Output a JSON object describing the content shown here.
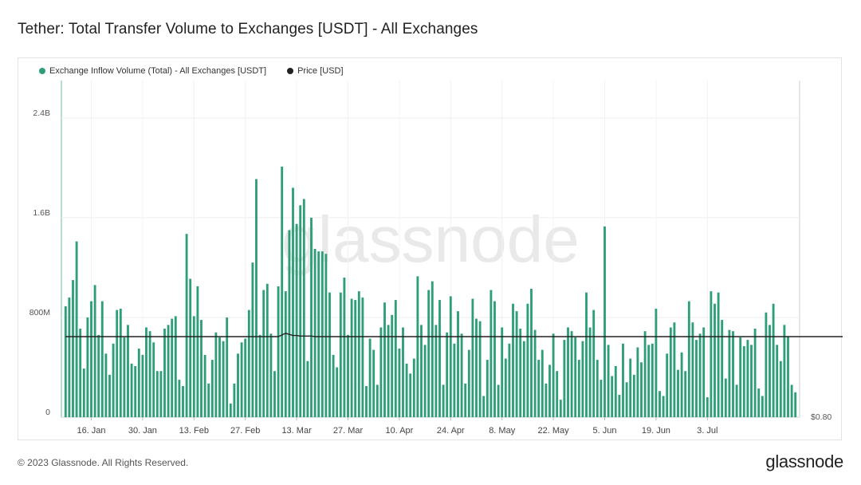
{
  "page": {
    "title": "Tether: Total Transfer Volume to Exchanges [USDT] - All Exchanges",
    "copyright": "© 2023 Glassnode. All Rights Reserved.",
    "brand": "glassnode",
    "watermark": "glassnode"
  },
  "legend": [
    {
      "name": "Exchange Inflow Volume (Total) - All Exchanges [USDT]",
      "color": "#2e9e79"
    },
    {
      "name": "Price [USD]",
      "color": "#222222"
    }
  ],
  "chart_data": {
    "type": "bar",
    "grid": true,
    "legend_position": "top-left",
    "x_ticks": [
      "16. Jan",
      "30. Jan",
      "13. Feb",
      "27. Feb",
      "13. Mar",
      "27. Mar",
      "10. Apr",
      "24. Apr",
      "8. May",
      "22. May",
      "5. Jun",
      "19. Jun",
      "3. Jul"
    ],
    "x_tick_index": [
      7,
      21,
      35,
      49,
      63,
      77,
      91,
      105,
      119,
      133,
      147,
      161,
      175
    ],
    "y_ticks": [
      "0",
      "800M",
      "1.6B",
      "2.4B"
    ],
    "y_tick_values": [
      0,
      800,
      1600,
      2400
    ],
    "ylim": [
      0,
      2700
    ],
    "y_unit": "M USDT",
    "right_axis_label": "$0.80",
    "series": [
      {
        "name": "Exchange Inflow Volume (Total) - All Exchanges [USDT]",
        "color": "#2e9e79",
        "values": [
          890,
          960,
          1100,
          1410,
          710,
          390,
          800,
          930,
          1060,
          660,
          930,
          510,
          340,
          590,
          860,
          870,
          640,
          740,
          430,
          410,
          550,
          500,
          720,
          690,
          600,
          370,
          370,
          710,
          740,
          790,
          810,
          300,
          250,
          1470,
          1110,
          810,
          1050,
          780,
          500,
          270,
          460,
          680,
          640,
          610,
          800,
          110,
          270,
          510,
          600,
          630,
          860,
          1240,
          1910,
          660,
          1020,
          1070,
          670,
          370,
          1050,
          2010,
          1010,
          1500,
          1840,
          1550,
          1700,
          1750,
          450,
          1600,
          1350,
          1330,
          1330,
          1310,
          1000,
          500,
          400,
          1000,
          1120,
          660,
          950,
          940,
          1010,
          960,
          250,
          630,
          540,
          260,
          720,
          920,
          740,
          820,
          940,
          550,
          720,
          430,
          350,
          470,
          1130,
          740,
          580,
          1020,
          1090,
          740,
          940,
          260,
          680,
          970,
          590,
          850,
          670,
          270,
          540,
          950,
          790,
          770,
          170,
          460,
          1020,
          930,
          260,
          720,
          470,
          590,
          910,
          850,
          710,
          610,
          910,
          1030,
          700,
          460,
          540,
          270,
          420,
          670,
          370,
          140,
          620,
          720,
          690,
          640,
          460,
          610,
          1000,
          720,
          860,
          460,
          300,
          1530,
          580,
          330,
          410,
          180,
          590,
          280,
          470,
          340,
          560,
          440,
          690,
          580,
          590,
          870,
          210,
          170,
          510,
          720,
          760,
          380,
          520,
          370,
          930,
          760,
          620,
          670,
          720,
          160,
          1010,
          910,
          1000,
          780,
          310,
          700,
          690,
          260,
          640,
          570,
          620,
          580,
          710,
          230,
          170,
          840,
          740,
          910,
          580,
          450,
          740,
          650,
          260,
          200
        ],
        "note": ""
      },
      {
        "name": "Price [USD]",
        "color": "#222222",
        "values": [
          1.0,
          1.0,
          1.0,
          1.0,
          1.0,
          1.0,
          1.0,
          1.0,
          1.0,
          1.0,
          1.0,
          1.0,
          1.0,
          1.0,
          1.0,
          1.0,
          1.0,
          1.0,
          1.0,
          1.0,
          1.0,
          1.0,
          1.0,
          1.0,
          1.0,
          1.0,
          1.0,
          1.0,
          1.0,
          1.0,
          1.0,
          1.0,
          1.0,
          1.0,
          1.0,
          1.0,
          1.0,
          1.0,
          1.0,
          1.0,
          1.0,
          1.0,
          1.0,
          1.0,
          1.0,
          1.0,
          1.0,
          1.0,
          1.0,
          1.0,
          1.0,
          1.0,
          1.0,
          1.0,
          1.0,
          1.0,
          1.0,
          1.0,
          1.0,
          1.003,
          1.006,
          1.004,
          1.002,
          1.002,
          1.001,
          1.001,
          1.001,
          1.001,
          1.0,
          1.0,
          1.0,
          1.0,
          1.0,
          1.0,
          1.0,
          1.0,
          1.0,
          1.0,
          1.0,
          1.0,
          1.0,
          1.0,
          1.0,
          1.0,
          1.0,
          1.0,
          1.0,
          1.0,
          1.0,
          1.0,
          1.0,
          1.0,
          1.0,
          1.0,
          1.0,
          1.0,
          1.0,
          1.0,
          1.0,
          1.0,
          1.0,
          1.0,
          1.0,
          1.0,
          1.0,
          1.0,
          1.0,
          1.0,
          1.0,
          1.0,
          1.0,
          1.0,
          1.0,
          1.0,
          1.0,
          1.0,
          1.0,
          1.0,
          1.0,
          1.0,
          1.0,
          1.0,
          1.0,
          1.0,
          1.0,
          1.0,
          1.0,
          1.0,
          1.0,
          1.0,
          1.0,
          1.0,
          1.0,
          1.0,
          1.0,
          1.0,
          1.0,
          1.0,
          1.0,
          1.0,
          1.0,
          1.0,
          1.0,
          1.0,
          1.0,
          1.0,
          1.0,
          1.0,
          1.0,
          1.0,
          1.0,
          1.0,
          1.0,
          1.0,
          1.0,
          1.0,
          1.0,
          1.0,
          1.0,
          1.0,
          1.0,
          1.0,
          1.0,
          1.0,
          1.0,
          1.0,
          1.0,
          1.0,
          1.0,
          1.0,
          1.0,
          1.0,
          1.0,
          1.0,
          1.0,
          1.0,
          1.0,
          1.0,
          1.0,
          1.0,
          1.0,
          1.0,
          1.0,
          1.0,
          1.0,
          1.0,
          1.0,
          1.0,
          1.0,
          1.0,
          1.0,
          1.0,
          1.0,
          1.0,
          1.0,
          1.0,
          1.0,
          1.0,
          1.0,
          1.0,
          1.0,
          1.0,
          1.0,
          1.0,
          1.0,
          1.0,
          1.0,
          1.0,
          1.0,
          1.0,
          1.0,
          1.0,
          1.0,
          1.0,
          1.0,
          1.0,
          1.0,
          1.0,
          1.0
        ]
      }
    ]
  }
}
